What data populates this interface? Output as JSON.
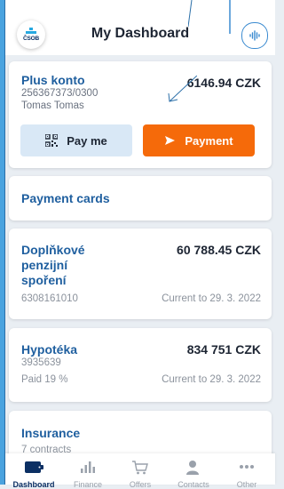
{
  "header": {
    "logo_text": "ČSOB",
    "title": "My Dashboard",
    "voice_icon": "voice-wave-icon"
  },
  "account": {
    "name": "Plus konto",
    "number": "256367373/0300",
    "owner": "Tomas Tomas",
    "balance": "6146.94 CZK",
    "pay_me_label": "Pay me",
    "payment_label": "Payment"
  },
  "payment_cards": {
    "title": "Payment cards"
  },
  "pension": {
    "title_line1": "Doplňkové",
    "title_line2": "penzijní",
    "title_line3": "spoření",
    "amount": "60 788.45 CZK",
    "number": "6308161010",
    "current": "Current to 29. 3. 2022"
  },
  "mortgage": {
    "title": "Hypotéka",
    "amount": "834 751 CZK",
    "number": "3935639",
    "paid": "Paid 19 %",
    "current": "Current to 29. 3. 2022"
  },
  "insurance": {
    "title": "Insurance",
    "contracts": "7 contracts"
  },
  "bottom_nav": [
    {
      "label": "Dashboard",
      "icon": "wallet-icon"
    },
    {
      "label": "Finance",
      "icon": "chart-bars-icon"
    },
    {
      "label": "Offers",
      "icon": "cart-icon"
    },
    {
      "label": "Contacts",
      "icon": "person-icon"
    },
    {
      "label": "Other",
      "icon": "more-dots-icon"
    }
  ],
  "colors": {
    "accent": "#1f5f9f",
    "payment_button": "#f56a0a",
    "pay_me_button": "#d9e8f6",
    "brand_navy": "#0b2f63"
  }
}
